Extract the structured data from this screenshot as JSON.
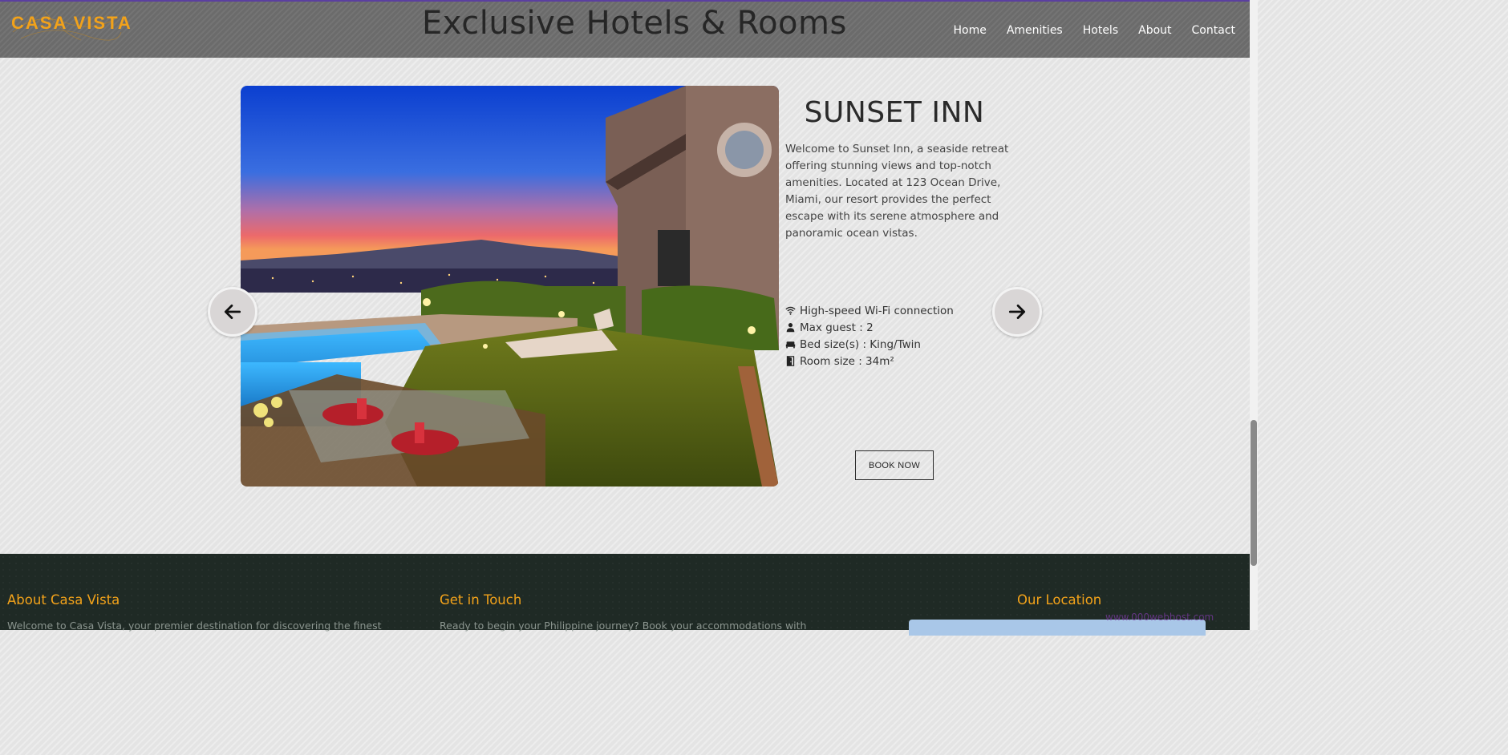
{
  "header": {
    "logo_text": "CASA VISTA",
    "title": "Exclusive Hotels & Rooms",
    "nav": [
      {
        "label": "Home"
      },
      {
        "label": "Amenities"
      },
      {
        "label": "Hotels"
      },
      {
        "label": "About"
      },
      {
        "label": "Contact"
      }
    ]
  },
  "slide": {
    "hotel_name": "SUNSET INN",
    "description": "Welcome to Sunset Inn, a seaside retreat offering stunning views and top-notch amenities. Located at 123 Ocean Drive, Miami, our resort provides the perfect escape with its serene atmosphere and panoramic ocean vistas.",
    "features": [
      {
        "icon": "wifi-icon",
        "text": "High-speed Wi-Fi connection"
      },
      {
        "icon": "person-icon",
        "text": "Max guest : 2"
      },
      {
        "icon": "bed-icon",
        "text": "Bed size(s) : King/Twin"
      },
      {
        "icon": "door-icon",
        "text": "Room size : 34m²"
      }
    ],
    "book_label": "BOOK NOW",
    "prev_icon": "arrow-left-icon",
    "next_icon": "arrow-right-icon"
  },
  "footer": {
    "about_title": "About Casa Vista",
    "about_text": "Welcome to Casa Vista, your premier destination for discovering the finest",
    "contact_title": "Get in Touch",
    "contact_text": "Ready to begin your Philippine journey? Book your accommodations with",
    "location_title": "Our Location",
    "map_watermark": "www.000webhost.com"
  },
  "colors": {
    "accent": "#f2a21a",
    "header_bg": "#6b6b6b",
    "footer_bg": "#1f2a25"
  }
}
